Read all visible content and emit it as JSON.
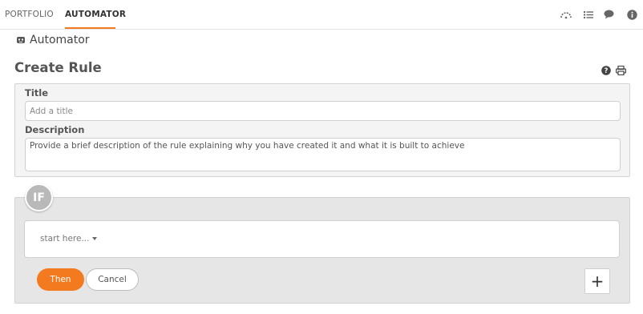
{
  "nav": {
    "tabs": [
      {
        "label": "PORTFOLIO",
        "active": false
      },
      {
        "label": "AUTOMATOR",
        "active": true
      }
    ],
    "icons": [
      "dashboard-gauge-icon",
      "list-icon",
      "chat-bubble-icon",
      "info-icon"
    ],
    "accent_color": "#f47a20"
  },
  "app": {
    "title": "Automator",
    "icon": "robot-icon"
  },
  "page": {
    "title": "Create Rule",
    "header_icons": [
      "help-icon",
      "print-icon"
    ]
  },
  "form": {
    "title_label": "Title",
    "title_value": "",
    "title_placeholder": "Add a title",
    "description_label": "Description",
    "description_value": "",
    "description_placeholder": "Provide a brief description of the rule explaining why you have created it and what it is built to achieve"
  },
  "if_block": {
    "badge": "IF",
    "start_text": "start here..."
  },
  "actions": {
    "then_label": "Then",
    "cancel_label": "Cancel",
    "add_symbol": "+"
  }
}
